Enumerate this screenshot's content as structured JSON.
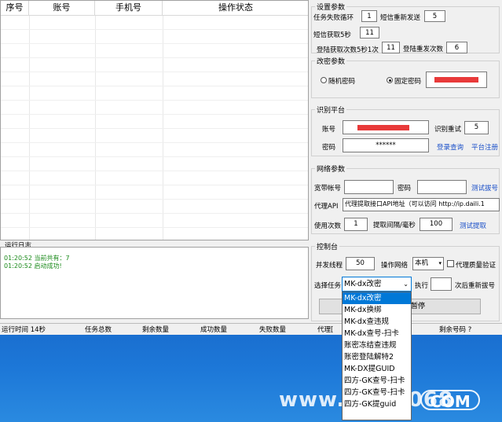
{
  "table": {
    "headers": [
      "序号",
      "账号",
      "手机号",
      "操作状态"
    ]
  },
  "log": {
    "title": "运行日志",
    "lines": [
      "01:20:52 当前共有：7",
      "01:20:52 启动成功!"
    ]
  },
  "settings": {
    "title": "设置参数",
    "task_fail_loop_label": "任务失败循环",
    "task_fail_loop_value": "1",
    "sms_resend_label": "短信重新发送",
    "sms_resend_value": "5",
    "sms_fetch_label": "短信获取5秒",
    "sms_fetch_value": "11",
    "login_fetch_label": "登陆获取次数5秒1次",
    "login_fetch_value": "11",
    "login_resend_label": "登陆重发次数",
    "login_resend_value": "6"
  },
  "password": {
    "title": "改密参数",
    "random_label": "随机密码",
    "fixed_label": "固定密码",
    "selected": "fixed"
  },
  "platform": {
    "title": "识别平台",
    "account_label": "账号",
    "password_label": "密码",
    "password_value": "******",
    "retry_label": "识别重试",
    "retry_value": "5",
    "login_query": "登录查询",
    "platform_register": "平台注册"
  },
  "network": {
    "title": "网络参数",
    "broadband_label": "宽带帐号",
    "bb_password_label": "密码",
    "test_dial": "测试拔号",
    "proxy_label": "代理API",
    "proxy_value": "代理提取接口API地址（可以访问 http://ip.daili.1",
    "use_count_label": "使用次数",
    "use_count_value": "1",
    "interval_label": "提取间隔/毫秒",
    "interval_value": "100",
    "test_fetch": "测试提取"
  },
  "console": {
    "title": "控制台",
    "threads_label": "并发线程",
    "threads_value": "50",
    "network_label": "操作网络",
    "network_value": "本机",
    "proxy_verify_label": "代理质量验证",
    "task_label": "选择任务",
    "task_value": "MK-dx改密",
    "execute_label": "执行",
    "execute_value": "",
    "redial_label": "次后重新拔号",
    "pause_label": "暂停"
  },
  "dropdown_items": [
    "MK-dx改密",
    "MK-dx换绑",
    "MK-dx查违规",
    "MK-dx查号-扫卡",
    "账密冻结查违规",
    "账密登陆解特2",
    "MK-DX提GUID",
    "四方-GK查号-扫卡",
    "四方-GK查号-扫卡",
    "四方-GK提guid"
  ],
  "dropdown_selected_index": 0,
  "status": {
    "runtime": "运行时间 14秒",
    "total": "任务总数",
    "remaining": "剩余数量",
    "success": "成功数量",
    "fail": "失败数量",
    "proxy": "代理[",
    "remaining_codes": "剩余号码 ?"
  },
  "watermark": {
    "text": "www.LXH6068",
    "com": "COM"
  },
  "colors": {
    "accent": "#0078d7",
    "redacted": "#e83a3a",
    "link": "#1a4fc8",
    "log_text": "#1a8a1a"
  }
}
